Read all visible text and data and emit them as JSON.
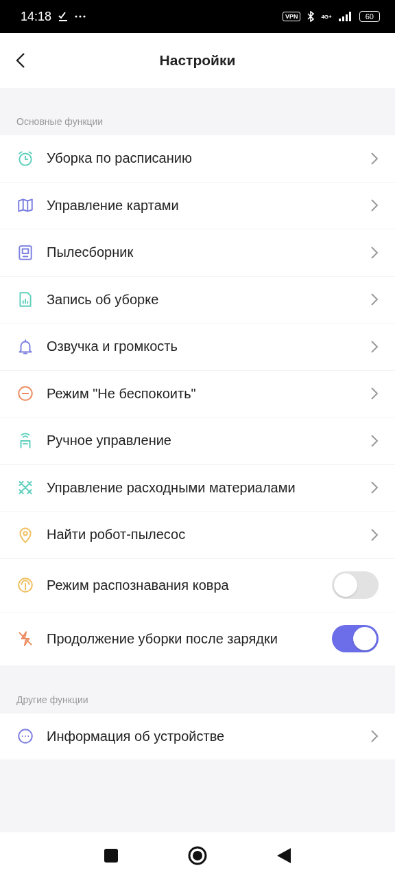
{
  "status_bar": {
    "time": "14:18",
    "vpn": "VPN",
    "network": "4G+",
    "battery": "60"
  },
  "header": {
    "title": "Настройки"
  },
  "sections": [
    {
      "title": "Основные функции",
      "items": [
        {
          "kind": "link",
          "label": "Уборка по расписанию"
        },
        {
          "kind": "link",
          "label": "Управление картами"
        },
        {
          "kind": "link",
          "label": "Пылесборник"
        },
        {
          "kind": "link",
          "label": "Запись об уборке"
        },
        {
          "kind": "link",
          "label": "Озвучка и громкость"
        },
        {
          "kind": "link",
          "label": "Режим \"Не беспокоить\""
        },
        {
          "kind": "link",
          "label": "Ручное управление"
        },
        {
          "kind": "link",
          "label": "Управление расходными материалами"
        },
        {
          "kind": "link",
          "label": "Найти робот-пылесос"
        },
        {
          "kind": "toggle",
          "label": "Режим распознавания ковра",
          "on": false
        },
        {
          "kind": "toggle",
          "label": "Продолжение уборки после зарядки",
          "on": true
        }
      ]
    },
    {
      "title": "Другие функции",
      "items": [
        {
          "kind": "link",
          "label": "Информация об устройстве"
        }
      ]
    }
  ]
}
